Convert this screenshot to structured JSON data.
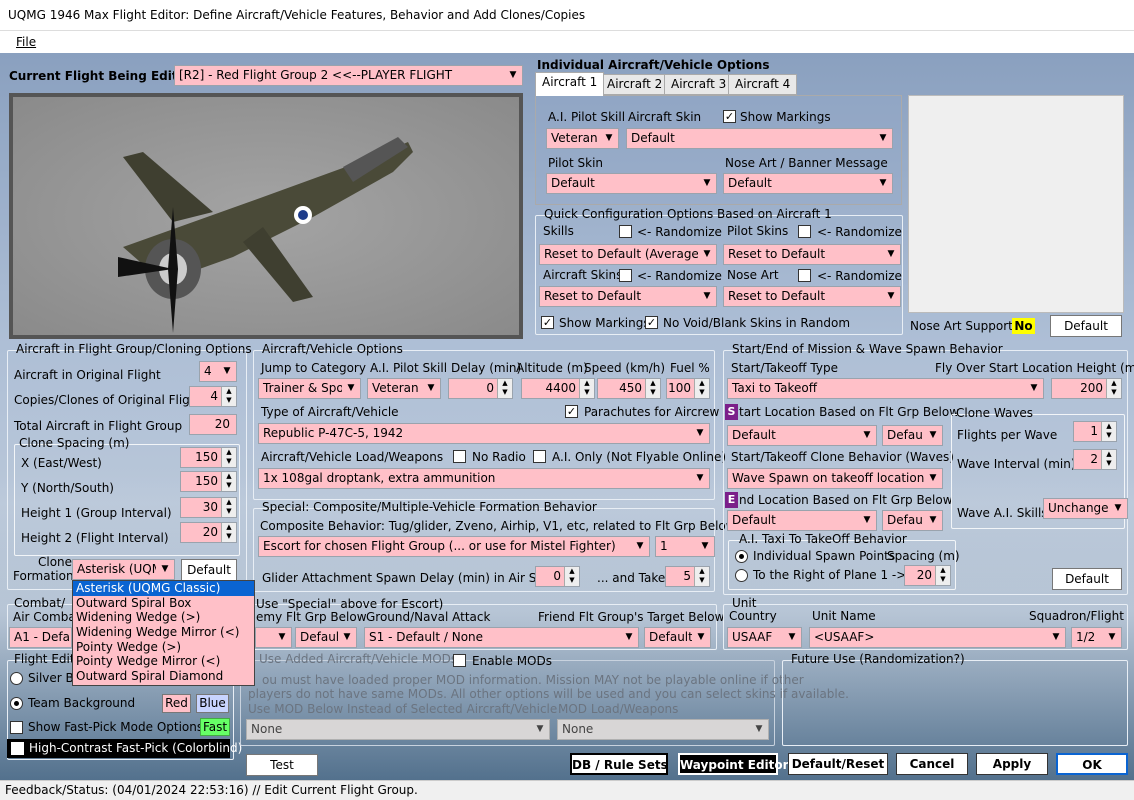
{
  "window": {
    "title": "UQMG 1946 Max Flight Editor:  Define Aircraft/Vehicle Features, Behavior and Add Clones/Copies"
  },
  "menu": {
    "file": "File"
  },
  "current_flight": {
    "label": "Current Flight Being Edited:",
    "value": "[R2] -  Red Flight Group  2     <<--PLAYER FLIGHT"
  },
  "individual": {
    "title": "Individual Aircraft/Vehicle Options",
    "tabs": [
      "Aircraft 1",
      "Aircraft 2",
      "Aircraft 3",
      "Aircraft 4"
    ],
    "ai_pilot_skill_label": "A.I. Pilot Skill",
    "ai_pilot_skill": "Veteran",
    "aircraft_skin_label": "Aircraft Skin",
    "aircraft_skin": "Default",
    "show_markings": "Show Markings",
    "pilot_skin_label": "Pilot Skin",
    "pilot_skin": "Default",
    "nose_art_label": "Nose Art / Banner Message",
    "nose_art": "Default"
  },
  "quick": {
    "title": "Quick Configuration Options Based on Aircraft 1",
    "skills": "Skills",
    "pilot_skins": "Pilot Skins",
    "aircraft_skins": "Aircraft Skins",
    "nose_art": "Nose Art",
    "randomize": "<- Randomize",
    "skills_value": "Reset to Default (Average)",
    "pilot_skins_value": "Reset to Default",
    "aircraft_skins_value": "Reset to Default",
    "nose_art_value": "Reset to Default",
    "show_markings": "Show Markings",
    "no_void": "No Void/Blank Skins in Random"
  },
  "nose_art_support": {
    "label": "Nose Art Support:",
    "value": "No",
    "button": "Default"
  },
  "cloning": {
    "title": "Aircraft in Flight Group/Cloning Options",
    "orig_label": "Aircraft in Original Flight",
    "orig": "4",
    "copies_label": "Copies/Clones of Original Flight",
    "copies": "4",
    "total_label": "Total Aircraft in Flight Group",
    "total": "20",
    "spacing_title": "Clone Spacing (m)",
    "x_label": "X (East/West)",
    "x": "150",
    "y_label": "Y (North/South)",
    "y": "150",
    "h1_label": "Height 1 (Group Interval)",
    "h1": "30",
    "h2_label": "Height 2 (Flight Interval)",
    "h2": "20",
    "formation_label1": "Clone",
    "formation_label2": "Formation",
    "formation": "Asterisk (UQM",
    "default_button": "Default"
  },
  "formation_options": [
    "Asterisk (UQMG Classic)",
    "Outward Spiral Box",
    "Widening Wedge (>)",
    "Widening Wedge Mirror (<)",
    "Pointy Wedge (>)",
    "Pointy Wedge Mirror (<)",
    "Outward Spiral Diamond"
  ],
  "vehicle": {
    "title": "Aircraft/Vehicle Options",
    "jump_label": "Jump to Category",
    "jump": "Trainer & Spor",
    "skill_label": "A.I. Pilot Skill",
    "skill": "Veteran",
    "delay_label": "Delay (min)",
    "delay": "0",
    "alt_label": "Altitude (m)",
    "alt": "4400",
    "speed_label": "Speed (km/h)",
    "speed": "450",
    "fuel_label": "Fuel %",
    "fuel": "100",
    "type_label": "Type of Aircraft/Vehicle",
    "type": "Republic P-47C-5, 1942",
    "parachutes": "Parachutes for Aircrew",
    "load_label": "Aircraft/Vehicle Load/Weapons",
    "load": "1x 108gal droptank, extra ammunition",
    "no_radio": "No Radio",
    "ai_only": "A.I. Only (Not Flyable Online)"
  },
  "special": {
    "title": "Special: Composite/Multiple-Vehicle Formation Behavior",
    "composite_label": "Composite Behavior: Tug/glider, Zveno, Airhip, V1, etc, related to Flt Grp Below",
    "composite": "Escort for chosen Flight Group (... or use for Mistel Fighter)",
    "composite_num": "1",
    "glider_label": "Glider Attachment Spawn Delay (min) in Air Start",
    "glider": "0",
    "takeoff_label": "... and Takeoff",
    "takeoff": "5"
  },
  "combat": {
    "title": "Combat/",
    "aircombat": "Air Combat",
    "aircombat_value": "A1 - Defau",
    "escort_title": "Use \"Special\" above for Escort)",
    "enemy_label": "emy Flt Grp Below",
    "enemy": "",
    "enemy_def": "Default",
    "ground_label": "Ground/Naval Attack",
    "ground": "S1 - Default / None",
    "friend_label": "Friend Flt Group's Target Below",
    "friend": "Default"
  },
  "flight_editor": {
    "title": "Flight Edito",
    "silver": "Silver B",
    "team": "Team Background",
    "red": "Red",
    "blue": "Blue",
    "fastpick": "Show Fast-Pick Mode Options",
    "fast": "Fast",
    "contrast": "High-Contrast Fast-Pick (Colorblind)"
  },
  "mods": {
    "title": "Use Added Aircraft/Vehicle MODs",
    "enable": "Enable MODs",
    "text1": "ou must have loaded proper MOD information. Mission MAY not be playable online if other",
    "text2": "players do not have same MODs.  All other options will be used and you can select skins if available.",
    "use_label": "Use MOD Below Instead of Selected Aircraft/Vehicle",
    "load_label": "MOD Load/Weapons",
    "mod": "None",
    "mod_load": "None"
  },
  "mission": {
    "title": "Start/End of Mission & Wave Spawn Behavior",
    "start_type_label": "Start/Takeoff Type",
    "start_type": "Taxi to Takeoff",
    "flyover_label": "Fly Over Start Location Height (m)",
    "flyover": "200",
    "start_loc_label": "tart Location Based on Flt Grp Below",
    "start_s": "S",
    "start_loc": "Default",
    "start_loc2": "Defau",
    "clone_beh_label": "Start/Takeoff Clone Behavior (Waves)",
    "clone_beh": "Wave Spawn on takeoff location",
    "end_loc_label": "nd Location Based on Flt Grp Below",
    "end_e": "E",
    "end_loc": "Default",
    "end_loc2": "Defau",
    "waves_title": "Clone Waves",
    "fpw_label": "Flights per Wave",
    "fpw": "1",
    "wi_label": "Wave Interval (min)",
    "wi": "2",
    "wai_label": "Wave A.I. Skills",
    "wai": "Unchange",
    "taxi_title": "A.I. Taxi To TakeOff Behavior",
    "indiv": "Individual Spawn Points",
    "spacing": "Spacing (m)",
    "right": "To the Right of Plane 1 ->",
    "right_val": "20",
    "default_button": "Default"
  },
  "unit": {
    "title": "Unit",
    "country_label": "Country",
    "country": "USAAF",
    "name_label": "Unit Name",
    "name": "<USAAF>",
    "sq_label": "Squadron/Flight",
    "sq": "1/2"
  },
  "future": {
    "title": "Future Use (Randomization?)"
  },
  "buttons": {
    "test": "Test",
    "db": "DB / Rule Sets",
    "waypoint": "Waypoint Editor",
    "reset": "Default/Reset",
    "cancel": "Cancel",
    "apply": "Apply",
    "ok": "OK"
  },
  "status": {
    "text": "Feedback/Status:  (04/01/2024 22:53:16) // Edit Current Flight Group."
  }
}
